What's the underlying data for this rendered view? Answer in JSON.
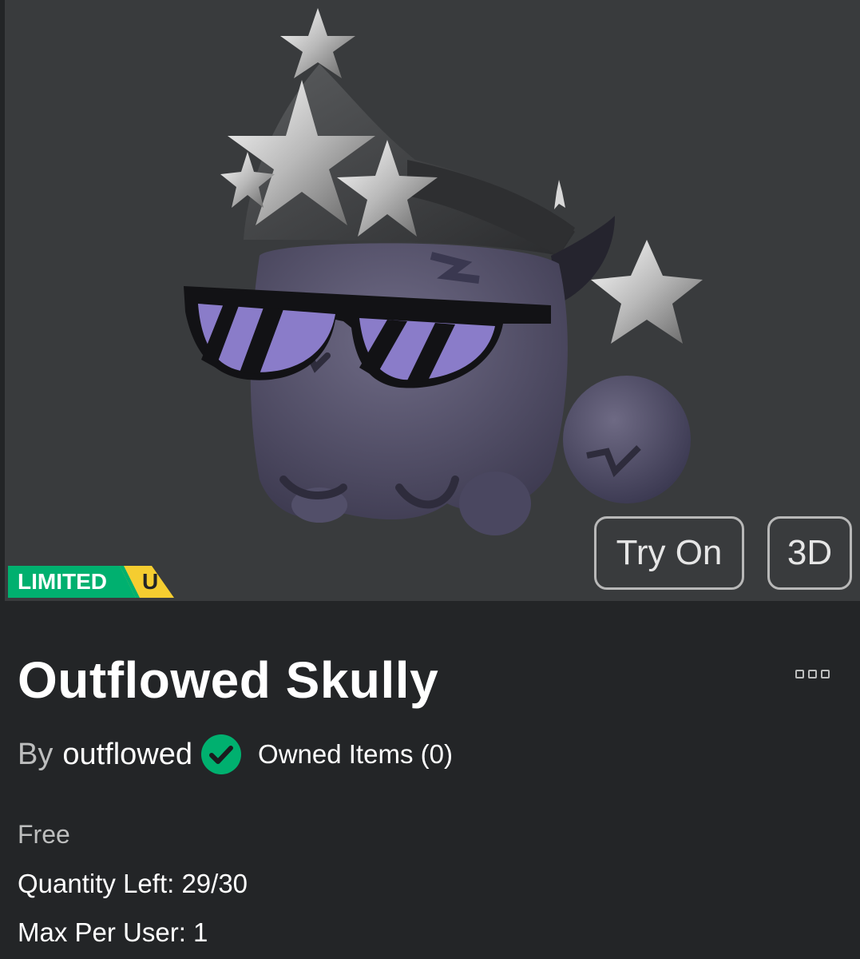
{
  "item": {
    "name": "Outflowed Skully",
    "badge_primary": "LIMITED",
    "badge_secondary": "U",
    "creator_prefix": "By",
    "creator": "outflowed",
    "owned_items": "Owned Items (0)",
    "price": "Free",
    "quantity_left": "Quantity Left: 29/30",
    "max_per_user": "Max Per User: 1"
  },
  "actions": {
    "try_on": "Try On",
    "view_3d": "3D"
  },
  "colors": {
    "preview_bg": "#393b3d",
    "page_bg": "#232527",
    "limited_green": "#00b06f",
    "unique_yellow": "#f5cd30",
    "verified_green": "#00b06f"
  },
  "icons": {
    "more": "more-options-icon",
    "verified": "verified-check-icon"
  }
}
